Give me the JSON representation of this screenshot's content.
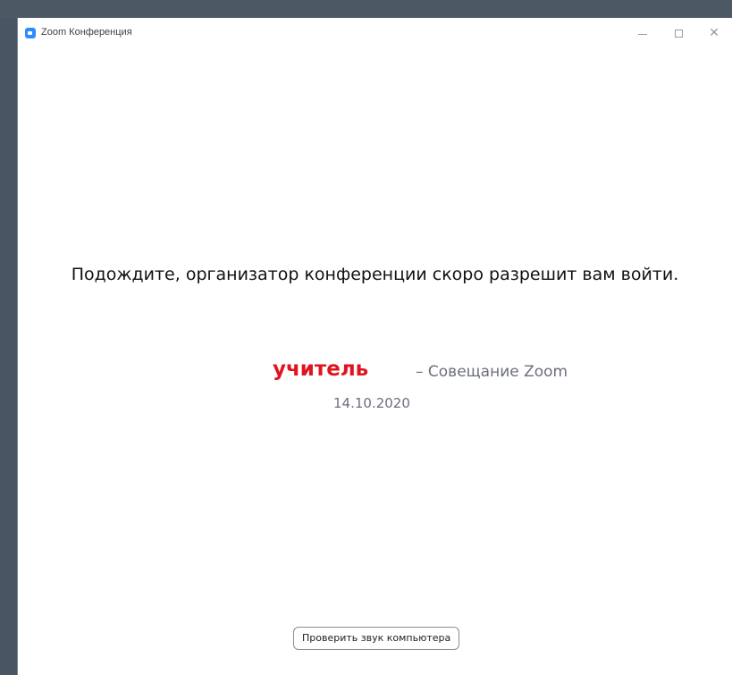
{
  "window": {
    "title": "Zoom Конференция",
    "icon": "zoom-camera-icon",
    "controls": {
      "minimize": "minimize-icon",
      "maximize": "maximize-icon",
      "close": "close-icon"
    }
  },
  "main": {
    "waiting_message": "Подождите, организатор конференции скоро разрешит вам войти.",
    "host_name": "учитель",
    "meeting_topic": "– Совещание Zoom",
    "meeting_date": "14.10.2020",
    "test_audio_label": "Проверить звук компьютера"
  },
  "colors": {
    "accent": "#2d8cff",
    "host_name": "#e0141e",
    "secondary_text": "#6b6f7e"
  }
}
